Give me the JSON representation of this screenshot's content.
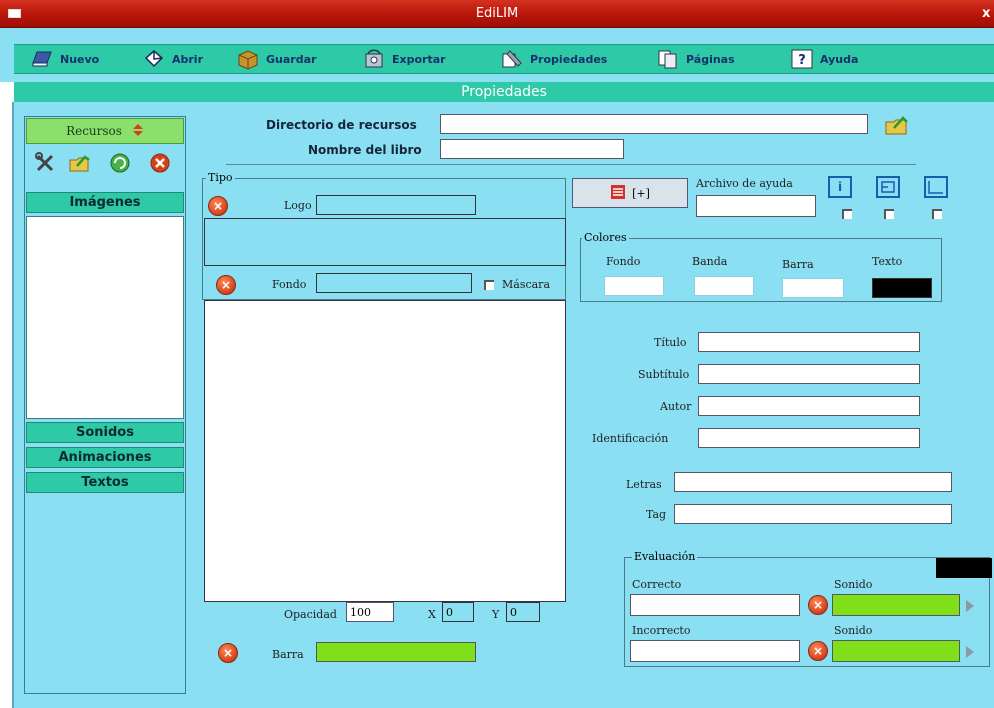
{
  "window": {
    "title": "EdiLIM",
    "close_glyph": "x"
  },
  "toolbar": {
    "items": [
      {
        "label": "Nuevo",
        "icon": "book-icon"
      },
      {
        "label": "Abrir",
        "icon": "open-icon"
      },
      {
        "label": "Guardar",
        "icon": "box-icon"
      },
      {
        "label": "Exportar",
        "icon": "export-icon"
      },
      {
        "label": "Propiedades",
        "icon": "properties-icon"
      },
      {
        "label": "Páginas",
        "icon": "pages-icon"
      },
      {
        "label": "Ayuda",
        "icon": "help-icon"
      }
    ]
  },
  "section_title": "Propiedades",
  "resources": {
    "title": "Recursos",
    "sections": [
      "Imágenes",
      "Sonidos",
      "Animaciones",
      "Textos"
    ]
  },
  "book": {
    "resource_dir_label": "Directorio de recursos",
    "resource_dir_value": "",
    "book_name_label": "Nombre del libro",
    "book_name_value": ""
  },
  "tipo": {
    "legend": "Tipo",
    "logo_label": "Logo",
    "logo_value": "",
    "fondo_label": "Fondo",
    "fondo_value": "",
    "mascara_label": "Máscara",
    "opacidad_label": "Opacidad",
    "opacidad_value": "100",
    "x_label": "X",
    "x_value": "0",
    "y_label": "Y",
    "y_value": "0",
    "barra_label": "Barra",
    "barra_value": ""
  },
  "help": {
    "add_label": "[+]",
    "archivo_label": "Archivo de ayuda",
    "archivo_value": "",
    "info_glyph": "i"
  },
  "colores": {
    "legend": "Colores",
    "fondo": {
      "label": "Fondo",
      "color": "#ffffff"
    },
    "banda": {
      "label": "Banda",
      "color": "#ffffff"
    },
    "barra": {
      "label": "Barra",
      "color": "#ffffff"
    },
    "texto": {
      "label": "Texto",
      "color": "#000000"
    }
  },
  "meta": {
    "titulo_label": "Título",
    "titulo_value": "",
    "subtitulo_label": "Subtítulo",
    "subtitulo_value": "",
    "autor_label": "Autor",
    "autor_value": "",
    "identificacion_label": "Identificación",
    "identificacion_value": "",
    "letras_label": "Letras",
    "letras_value": "",
    "tag_label": "Tag",
    "tag_value": ""
  },
  "evaluacion": {
    "legend": "Evaluación",
    "correcto_label": "Correcto",
    "correcto_value": "",
    "sonido_label": "Sonido",
    "incorrecto_label": "Incorrecto",
    "incorrecto_value": "",
    "sonido2_label": "Sonido"
  }
}
